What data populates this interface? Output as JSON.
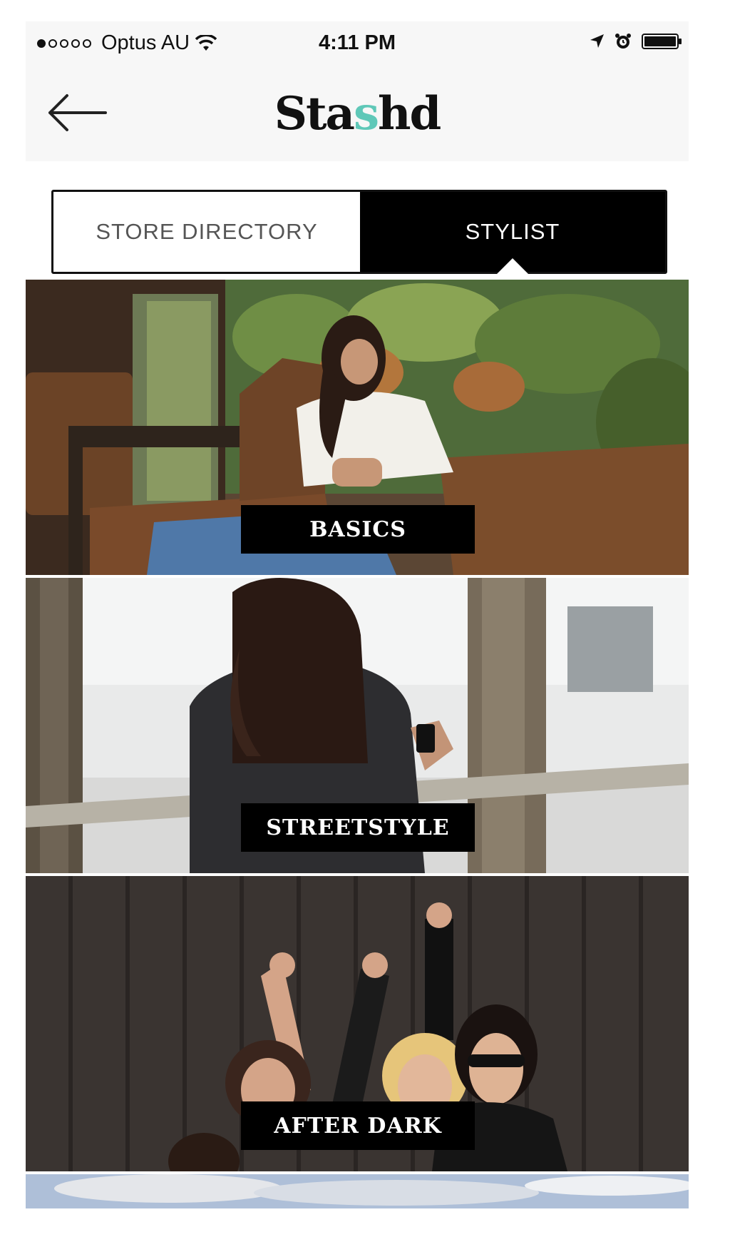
{
  "status_bar": {
    "carrier": "Optus AU",
    "time": "4:11 PM",
    "signal_strength": 1,
    "icons": [
      "wifi-icon",
      "location-arrow-icon",
      "alarm-icon",
      "battery-icon"
    ]
  },
  "nav": {
    "back_icon": "arrow-left-icon",
    "logo_part1": "Sta",
    "logo_accent": "s",
    "logo_part2": "hd",
    "accent_color": "#5fc8b8"
  },
  "tabs": [
    {
      "label": "STORE DIRECTORY",
      "selected": false
    },
    {
      "label": "STYLIST",
      "selected": true
    }
  ],
  "categories": [
    {
      "label": "BASICS"
    },
    {
      "label": "STREETSTYLE"
    },
    {
      "label": "AFTER DARK"
    }
  ]
}
